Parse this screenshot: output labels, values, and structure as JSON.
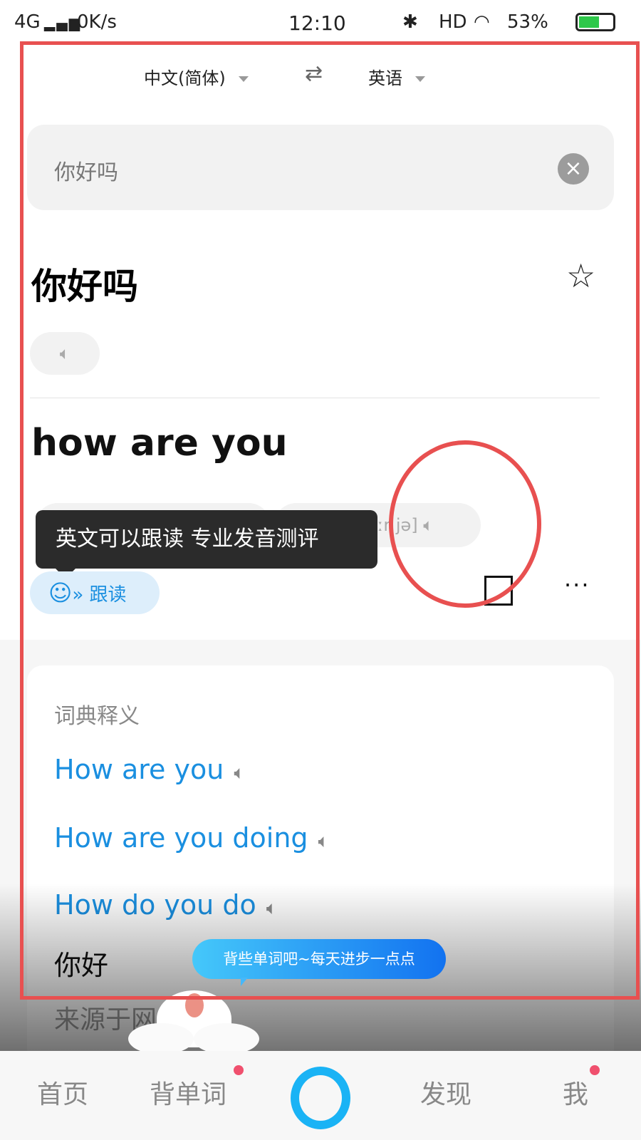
{
  "status_bar": {
    "network": "4G",
    "speed": "0K/s",
    "time": "12:10",
    "hd": "HD",
    "battery": "53%"
  },
  "lang_bar": {
    "source": "中文(简体)",
    "target": "英语",
    "swap_icon": "swap-arrows-icon"
  },
  "input": {
    "value": "你好吗"
  },
  "source": {
    "text": "你好吗"
  },
  "result": {
    "text": "how are you",
    "phonetic_visible": "ɑːr jə]",
    "follow_read_label": "跟读"
  },
  "tooltip": {
    "text": "英文可以跟读 专业发音测评"
  },
  "dictionary": {
    "title": "词典释义",
    "items": [
      {
        "text": "How are you"
      },
      {
        "text": "How are you doing"
      },
      {
        "text": "How do you do"
      }
    ],
    "meaning": "你好",
    "source_label": "来源于网"
  },
  "mascot_bubble": "背些单词吧~每天进步一点点",
  "nav": {
    "items": [
      {
        "label": "首页"
      },
      {
        "label": "背单词"
      },
      {
        "label": "发现"
      },
      {
        "label": "我"
      }
    ]
  },
  "colors": {
    "accent": "#1a8fe0",
    "annotation": "#e85050",
    "badge": "#f0506e"
  }
}
